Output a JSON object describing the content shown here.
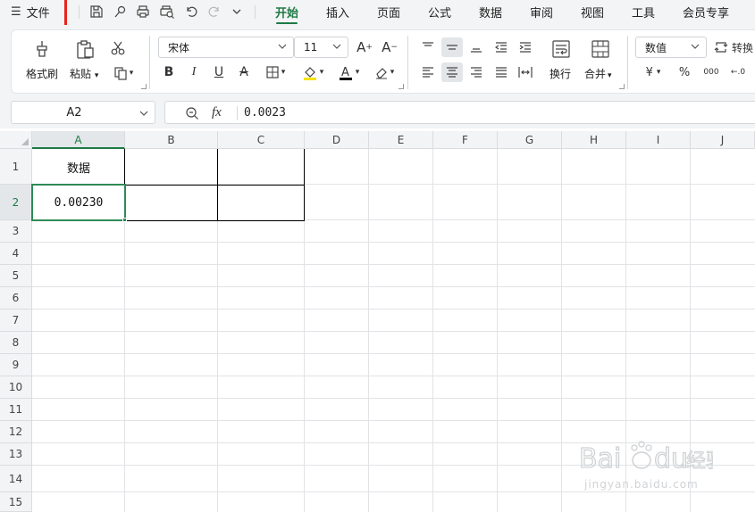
{
  "menu": {
    "file_label": "文件"
  },
  "tabs": [
    {
      "label": "开始",
      "active": true
    },
    {
      "label": "插入"
    },
    {
      "label": "页面"
    },
    {
      "label": "公式"
    },
    {
      "label": "数据"
    },
    {
      "label": "审阅"
    },
    {
      "label": "视图"
    },
    {
      "label": "工具"
    },
    {
      "label": "会员专享"
    }
  ],
  "ribbon": {
    "format_painter": "格式刷",
    "paste": "粘贴",
    "font_name": "宋体",
    "font_size": "11",
    "wrap": "换行",
    "merge": "合并",
    "number_format": "数值",
    "convert": "转换",
    "currency_symbol": "¥",
    "percent_symbol": "%",
    "thousands_symbol": "000"
  },
  "formula_bar": {
    "name_box": "A2",
    "fx": "fx",
    "value": "0.0023"
  },
  "sheet": {
    "columns": [
      "A",
      "B",
      "C",
      "D",
      "E",
      "F",
      "G",
      "H",
      "I",
      "J"
    ],
    "rows": [
      "1",
      "2",
      "3",
      "4",
      "5",
      "6",
      "7",
      "8",
      "9",
      "10",
      "11",
      "12",
      "13",
      "14",
      "15"
    ],
    "selected_cell": "A2",
    "cells": {
      "A1": "数据",
      "A2": "0.00230"
    }
  },
  "watermark": {
    "brand": "Bai du 经验",
    "url": "jingyan.baidu.com"
  },
  "colors": {
    "accent": "#1e7a45",
    "selection": "#2e8b57",
    "highlight_box": "#e8231c"
  }
}
